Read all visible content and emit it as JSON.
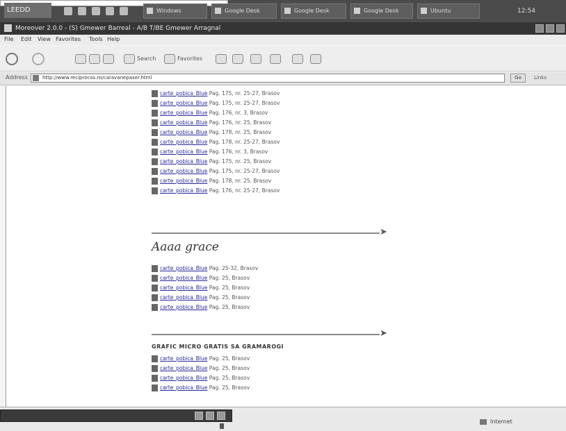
{
  "taskbar": {
    "start_label": "LEEDD",
    "buttons": [
      "Windows",
      "Google Desk",
      "Google Desk",
      "Google Desk",
      "Ubuntu"
    ],
    "clock": "12:54"
  },
  "window": {
    "title": "Moreover 2.0.0 - (S) Gmewer Barreal - A/B T/BE Gmewer Arragnal"
  },
  "menu": [
    "File",
    "Edit",
    "View",
    "Favorites",
    "Tools",
    "Help"
  ],
  "toolbar": {
    "back": "Back",
    "search": "Search",
    "favorites": "Favorites"
  },
  "address": {
    "label": "Address",
    "url": "http://www.reciprocos.ro/caravanepaser.html",
    "go": "Go",
    "links": "Links"
  },
  "section1": {
    "items": [
      {
        "link": "carte_pobica_Blue",
        "text": "Pag. 175, nr. 25-27, Brasov"
      },
      {
        "link": "carte_pobica_Blue",
        "text": "Pag. 175, nr. 25-27, Brasov"
      },
      {
        "link": "carte_pobica_Blue",
        "text": "Pag. 176, nr. 3, Brasov"
      },
      {
        "link": "carte_pobica_Blue",
        "text": "Pag. 176, nr. 25, Brasov"
      },
      {
        "link": "carte_pobica_Blue",
        "text": "Pag. 178, nr. 25, Brasov"
      },
      {
        "link": "carte_pobica_Blue",
        "text": "Pag. 178, nr. 25-27, Brasov"
      },
      {
        "link": "carte_pobica_Blue",
        "text": "Pag. 176, nr. 3, Brasov"
      },
      {
        "link": "carte_pobica_Blue",
        "text": "Pag. 175, nr. 25, Brasov"
      },
      {
        "link": "carte_pobica_Blue",
        "text": "Pag. 175, nr. 25-27, Brasov"
      },
      {
        "link": "carte_pobica_Blue",
        "text": "Pag. 178, nr. 25, Brasov"
      },
      {
        "link": "carte_pobica_Blue",
        "text": "Pag. 176, nr. 25-27, Brasov"
      }
    ]
  },
  "section2": {
    "heading": "Aaaa grace",
    "items": [
      {
        "link": "carte_pobica_Blue",
        "text": "Pag. 25-32, Brasov"
      },
      {
        "link": "carte_pobica_Blue",
        "text": "Pag. 25, Brasov"
      },
      {
        "link": "carte_pobica_Blue",
        "text": "Pag. 25, Brasov"
      },
      {
        "link": "carte_pobica_Blue",
        "text": "Pag. 25, Brasov"
      },
      {
        "link": "carte_pobica_Blue",
        "text": "Pag. 25, Brasov"
      }
    ]
  },
  "section3": {
    "heading": "GRAFIC MICRO GRATIS SA GRAMAROGI",
    "items": [
      {
        "link": "carte_pobica_Blue",
        "text": "Pag. 25, Brasov"
      },
      {
        "link": "carte_pobica_Blue",
        "text": "Pag. 25, Brasov"
      },
      {
        "link": "carte_pobica_Blue",
        "text": "Pag. 25, Brasov"
      },
      {
        "link": "carte_pobica_Blue",
        "text": "Pag. 25, Brasov"
      }
    ]
  },
  "status": {
    "zone": "Internet"
  }
}
